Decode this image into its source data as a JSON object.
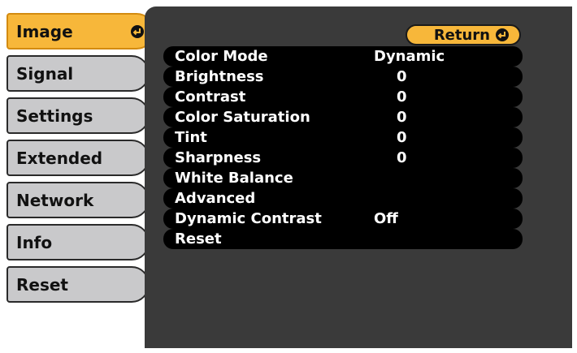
{
  "sidebar": {
    "items": [
      {
        "label": "Image"
      },
      {
        "label": "Signal"
      },
      {
        "label": "Settings"
      },
      {
        "label": "Extended"
      },
      {
        "label": "Network"
      },
      {
        "label": "Info"
      },
      {
        "label": "Reset"
      }
    ],
    "selected": "Image"
  },
  "return_button": {
    "label": "Return"
  },
  "menu": {
    "rows": [
      {
        "label": "Color Mode",
        "value": "Dynamic"
      },
      {
        "label": "Brightness",
        "value": "0"
      },
      {
        "label": "Contrast",
        "value": "0"
      },
      {
        "label": "Color Saturation",
        "value": "0"
      },
      {
        "label": "Tint",
        "value": "0"
      },
      {
        "label": "Sharpness",
        "value": "0"
      },
      {
        "label": "White Balance",
        "value": ""
      },
      {
        "label": "Advanced",
        "value": ""
      },
      {
        "label": "Dynamic Contrast",
        "value": "Off"
      },
      {
        "label": "Reset",
        "value": ""
      }
    ]
  },
  "colors": {
    "accent": "#f7b73a",
    "panel": "#3a3a3a",
    "tab": "#c9c9cb",
    "row": "#000000"
  },
  "icons": {
    "enter": "enter-icon"
  }
}
